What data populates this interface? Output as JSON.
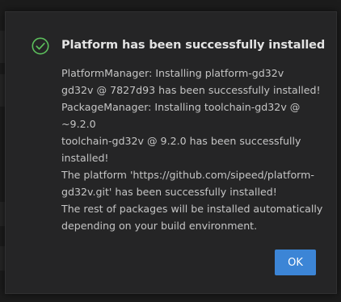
{
  "dialog": {
    "title": "Platform has been successfully installed",
    "status_icon": "check-circle-icon",
    "message_lines": [
      "PlatformManager: Installing platform-gd32v",
      "gd32v @ 7827d93 has been successfully installed!",
      "PackageManager: Installing toolchain-gd32v @",
      "~9.2.0",
      "toolchain-gd32v @ 9.2.0 has been successfully",
      "installed!",
      "The platform 'https://github.com/sipeed/platform-",
      "gd32v.git' has been successfully installed!",
      "The rest of packages will be installed automatically",
      "depending on your build environment."
    ],
    "ok_label": "OK"
  },
  "colors": {
    "success": "#5cbf5c",
    "button": "#3c85d6",
    "dialog_bg": "#252526"
  }
}
